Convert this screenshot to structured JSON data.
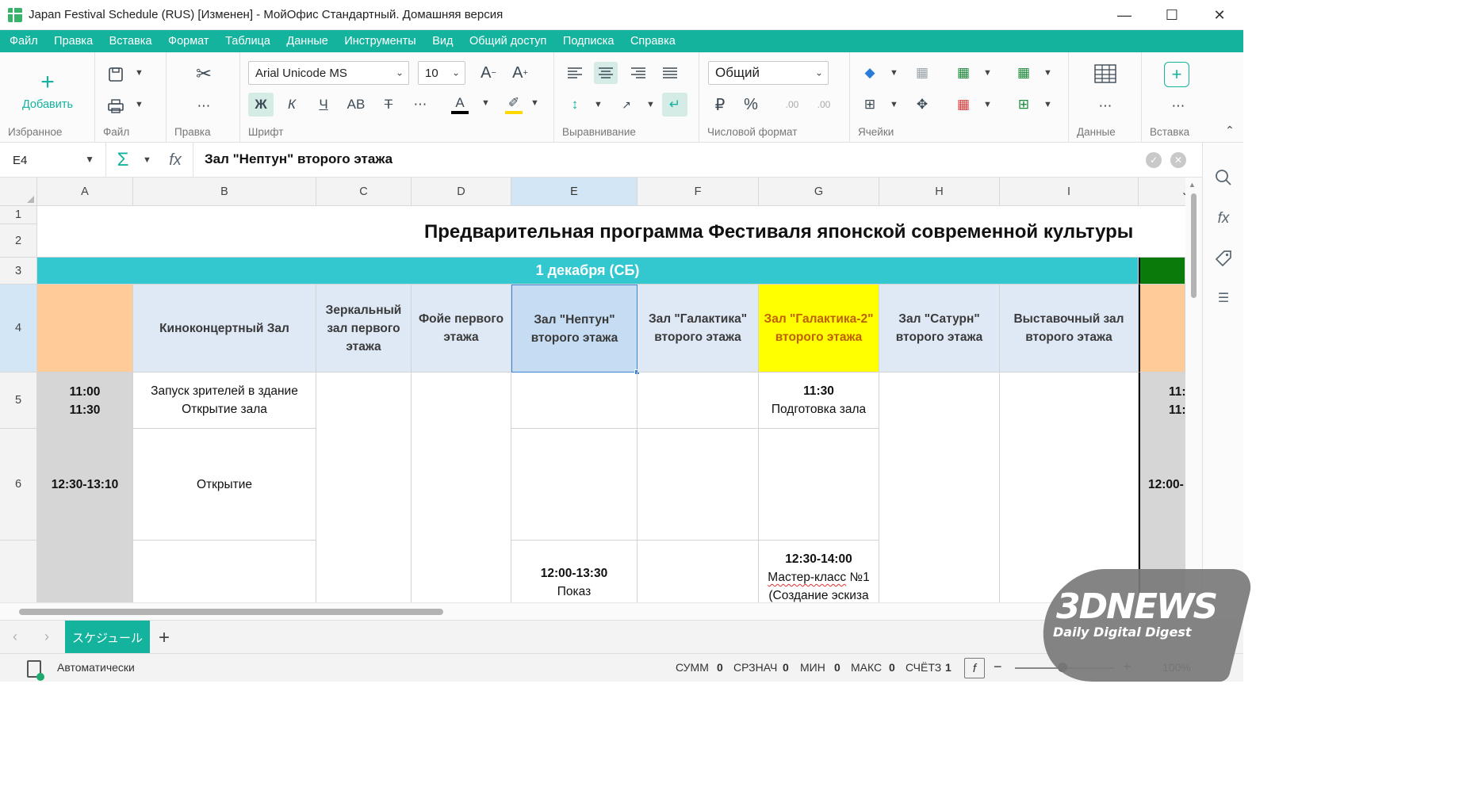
{
  "window": {
    "title": "Japan Festival Schedule (RUS) [Изменен] - МойОфис Стандартный. Домашняя версия"
  },
  "menu": [
    "Файл",
    "Правка",
    "Вставка",
    "Формат",
    "Таблица",
    "Данные",
    "Инструменты",
    "Вид",
    "Общий доступ",
    "Подписка",
    "Справка"
  ],
  "ribbon": {
    "add_label": "Добавить",
    "groups": {
      "favorites": "Избранное",
      "file": "Файл",
      "edit": "Правка",
      "font": "Шрифт",
      "align": "Выравнивание",
      "number": "Числовой формат",
      "cells": "Ячейки",
      "data": "Данные",
      "insert": "Вставка"
    },
    "font_name": "Arial Unicode MS",
    "font_size": "10",
    "number_format": "Общий",
    "bold": "Ж",
    "italic": "К",
    "underline": "Ч",
    "case": "АВ",
    "font_color": "#000000",
    "highlight_color": "#ffd800",
    "accent": "#14b39e"
  },
  "formula": {
    "cell_ref": "E4",
    "content": "Зал \"Нептун\" второго этажа"
  },
  "grid": {
    "columns": [
      "A",
      "B",
      "C",
      "D",
      "E",
      "F",
      "G",
      "H",
      "I",
      "J"
    ],
    "rows": [
      "1",
      "2",
      "3",
      "4",
      "5",
      "6"
    ],
    "title": "Предварительная программа Фестиваля японской современной культуры",
    "day_header": "1 декабря (СБ)",
    "halls": {
      "b": "Киноконцертный Зал",
      "c": "Зеркальный зал первого этажа",
      "d": "Фойе первого этажа",
      "e": "Зал \"Нептун\" второго этажа",
      "f": "Зал \"Галактика\" второго этажа",
      "g": "Зал \"Галактика-2\" второго этажа",
      "h": "Зал \"Сатурн\" второго этажа",
      "i": "Выставочный зал второго этажа"
    },
    "a5_line1": "11:00",
    "a5_line2": "11:30",
    "b5_line1": "Запуск зрителей в здание",
    "b5_line2": "Открытие зала",
    "g5_time": "11:30",
    "g5_text": "Подготовка зала",
    "a6": "12:30-13:10",
    "b6": "Открытие",
    "e7_time": "12:00-13:30",
    "e7_text": "Показ",
    "g7_time": "12:30-14:00",
    "g7_text1": "Мастер-класс",
    "g7_text2": "№1",
    "g7_text3": "(Создание эскиза",
    "j5_line1": "11:",
    "j5_line2": "11:",
    "j6": "12:00-",
    "colors": {
      "day_bar": "#33c8cf",
      "time_col": "#d6d6d6",
      "a4_fill": "#ffcc99",
      "g4_fill": "#ffff00",
      "j3_fill": "#0a7a0a",
      "selection": "#c5dcf2"
    }
  },
  "sheets": {
    "active": "スケジュール"
  },
  "status": {
    "mode": "Автоматически",
    "sum_label": "СУММ",
    "sum": "0",
    "avg_label": "СРЗНАЧ",
    "avg": "0",
    "min_label": "МИН",
    "min": "0",
    "max_label": "МАКС",
    "max": "0",
    "count_label": "СЧЁТЗ",
    "count": "1",
    "zoom": "100%"
  },
  "watermark": {
    "brand": "3DNEWS",
    "tagline": "Daily Digital Digest"
  }
}
